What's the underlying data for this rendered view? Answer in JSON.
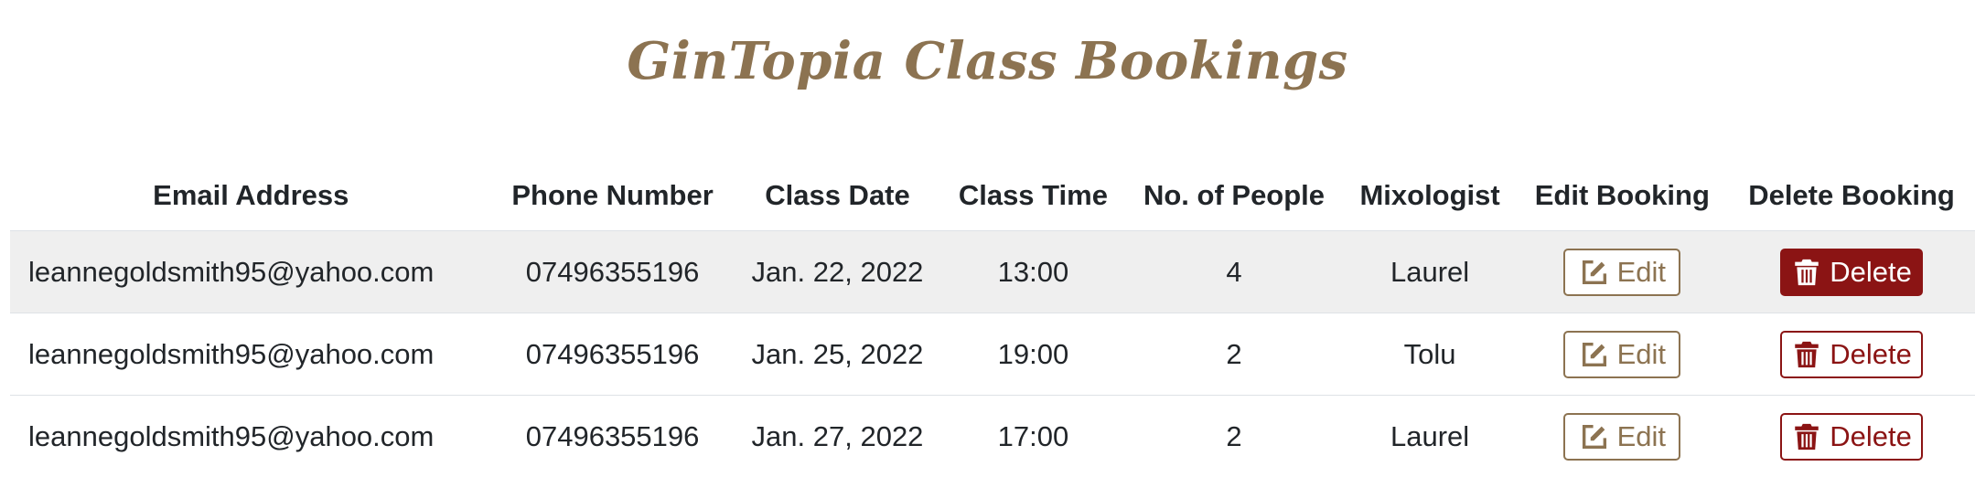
{
  "page": {
    "title": "GinTopia Class Bookings"
  },
  "table": {
    "headers": {
      "email": "Email Address",
      "phone": "Phone Number",
      "date": "Class Date",
      "time": "Class Time",
      "people": "No. of People",
      "mixologist": "Mixologist",
      "edit": "Edit Booking",
      "delete": "Delete Booking"
    },
    "rows": [
      {
        "email": "leannegoldsmith95@yahoo.com",
        "phone": "07496355196",
        "date": "Jan. 22, 2022",
        "time": "13:00",
        "people": "4",
        "mixologist": "Laurel",
        "edit_label": "Edit",
        "delete_label": "Delete",
        "delete_state": "hovered"
      },
      {
        "email": "leannegoldsmith95@yahoo.com",
        "phone": "07496355196",
        "date": "Jan. 25, 2022",
        "time": "19:00",
        "people": "2",
        "mixologist": "Tolu",
        "edit_label": "Edit",
        "delete_label": "Delete",
        "delete_state": "normal"
      },
      {
        "email": "leannegoldsmith95@yahoo.com",
        "phone": "07496355196",
        "date": "Jan. 27, 2022",
        "time": "17:00",
        "people": "2",
        "mixologist": "Laurel",
        "edit_label": "Edit",
        "delete_label": "Delete",
        "delete_state": "normal"
      }
    ]
  },
  "icons": {
    "edit": "edit-icon",
    "delete": "trash-icon"
  },
  "colors": {
    "accent": "#8c7351",
    "danger": "#8b1414",
    "stripe": "#efefef"
  }
}
